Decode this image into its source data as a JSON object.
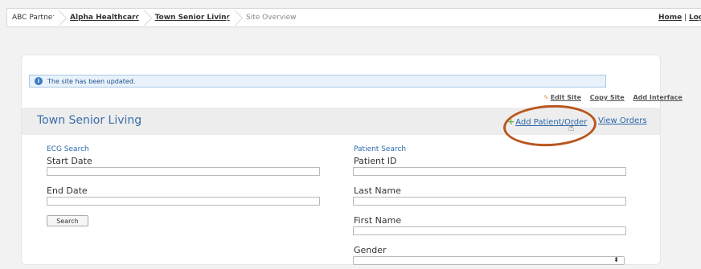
{
  "breadcrumb": {
    "partner": "ABC Partner",
    "company": "Alpha Healthcare",
    "site": "Town Senior Living",
    "current": "Site Overview"
  },
  "top_links": {
    "home": "Home",
    "separator": "|",
    "logout": "Logou"
  },
  "alert": {
    "message": "The site has been updated.",
    "icon": "info-icon"
  },
  "site_actions": {
    "edit": "Edit Site",
    "copy": "Copy Site",
    "add_interface": "Add Interface"
  },
  "site": {
    "title": "Town Senior Living",
    "add_patient": "Add Patient/Order",
    "view_orders": "View Orders"
  },
  "ecg_search": {
    "heading": "ECG Search",
    "start_date_label": "Start Date",
    "start_date_value": "",
    "end_date_label": "End Date",
    "end_date_value": "",
    "search_button": "Search"
  },
  "patient_search": {
    "heading": "Patient Search",
    "patient_id_label": "Patient ID",
    "patient_id_value": "",
    "last_name_label": "Last Name",
    "last_name_value": "",
    "first_name_label": "First Name",
    "first_name_value": "",
    "gender_label": "Gender",
    "gender_value": ""
  },
  "colors": {
    "accent": "#2b66a8",
    "highlight_ring": "#b8571f",
    "alert_bg": "#e9f2fb"
  }
}
